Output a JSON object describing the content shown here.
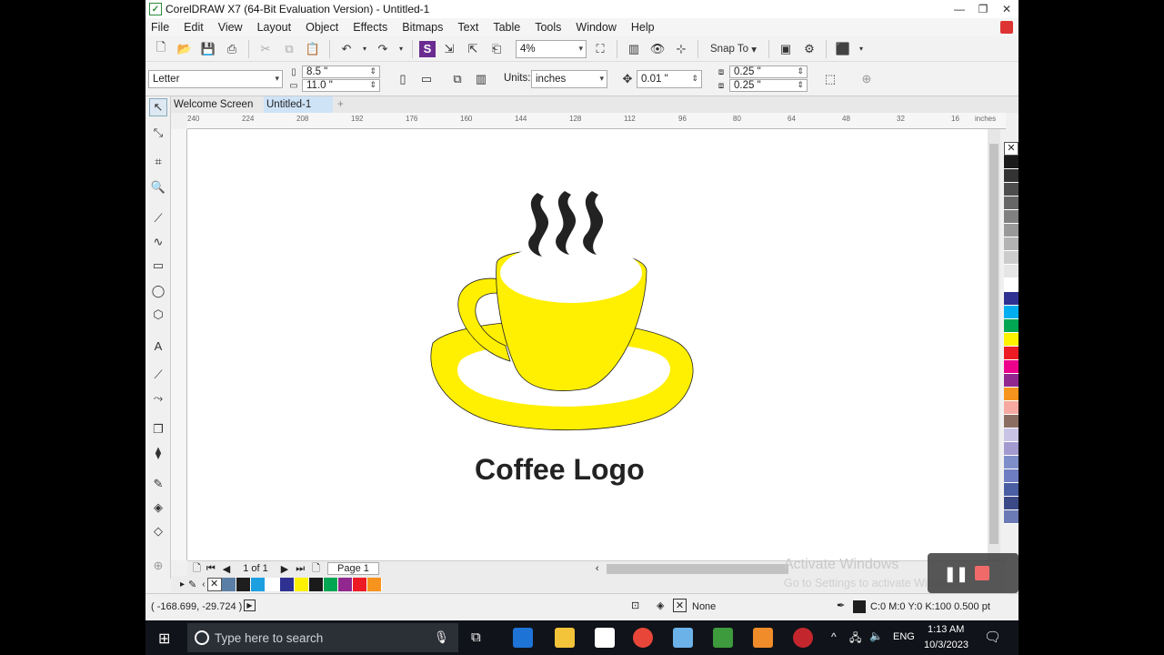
{
  "window": {
    "title": "CorelDRAW X7 (64-Bit Evaluation Version) - Untitled-1",
    "min": "—",
    "max": "❐",
    "close": "✕"
  },
  "menu": [
    "File",
    "Edit",
    "View",
    "Layout",
    "Object",
    "Effects",
    "Bitmaps",
    "Text",
    "Table",
    "Tools",
    "Window",
    "Help"
  ],
  "toolbar": {
    "zoom": "4%",
    "snap_to": "Snap To"
  },
  "propbar": {
    "paper": "Letter",
    "width": "8.5 \"",
    "height": "11.0 \"",
    "units_label": "Units:",
    "units": "inches",
    "nudge": "0.01 \"",
    "dup_x": "0.25 \"",
    "dup_y": "0.25 \""
  },
  "tabs": {
    "welcome": "Welcome Screen",
    "doc": "Untitled-1",
    "add": "+"
  },
  "ruler": {
    "h_ticks": [
      "240",
      "224",
      "208",
      "192",
      "176",
      "160",
      "144",
      "128",
      "112",
      "96",
      "80",
      "64",
      "48",
      "32",
      "16"
    ],
    "unit": "inches"
  },
  "canvas": {
    "logo_text": "Coffee Logo",
    "cup_color": "#ffef00"
  },
  "pagebar": {
    "counter": "1 of 1",
    "page_tab": "Page 1"
  },
  "doc_palette": [
    "#5b7fa6",
    "#1e1e1e",
    "#1ca0e0",
    "#ffffff",
    "#2e3192",
    "#fff200",
    "#1a1a1a",
    "#00a651",
    "#92278f",
    "#ed1c24",
    "#f7941d"
  ],
  "palette": [
    "#1a1a1a",
    "#333333",
    "#4d4d4d",
    "#666666",
    "#808080",
    "#999999",
    "#b3b3b3",
    "#cccccc",
    "#e6e6e6",
    "#ffffff",
    "#2e3192",
    "#00aeef",
    "#00a651",
    "#fff200",
    "#ed1c24",
    "#ec008c",
    "#92278f",
    "#f7941d",
    "#f5a9a0",
    "#8c6d62",
    "#c9c3e6",
    "#a39ad0",
    "#7d8ec8",
    "#6e7cc2",
    "#4a5ea3",
    "#3b4a86",
    "#6b79b5"
  ],
  "status": {
    "coords": "( -168.699, -29.724 )",
    "fill": "None",
    "outline": "C:0 M:0 Y:0 K:100  0.500 pt"
  },
  "activation": {
    "line1": "Activate Windows",
    "line2": "Go to Settings to activate Windows."
  },
  "taskbar": {
    "search_placeholder": "Type here to search",
    "lang": "ENG",
    "time": "1:13 AM",
    "date": "10/3/2023"
  }
}
